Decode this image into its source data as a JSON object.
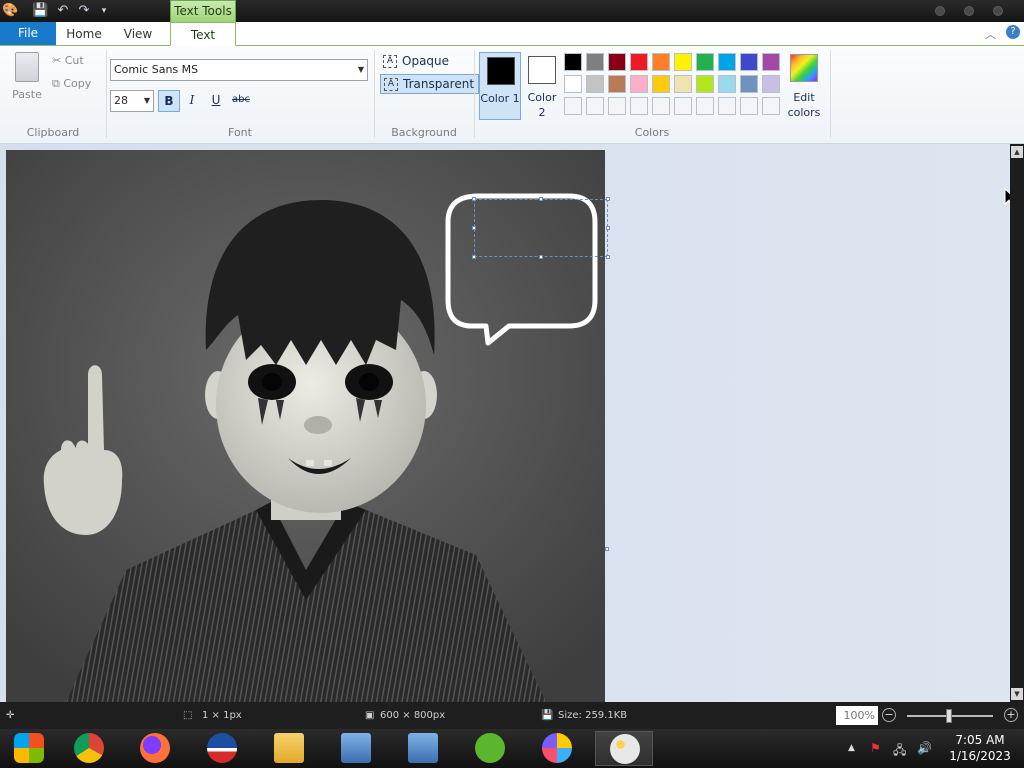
{
  "titlebar": {
    "context_tab": "Text Tools"
  },
  "tabs": {
    "file": "File",
    "home": "Home",
    "view": "View",
    "text": "Text"
  },
  "clipboard": {
    "paste": "Paste",
    "cut": "Cut",
    "copy": "Copy",
    "group": "Clipboard"
  },
  "font": {
    "family": "Comic Sans MS",
    "size": "28",
    "bold": "B",
    "italic": "I",
    "underline": "U",
    "strike": "abc",
    "group": "Font"
  },
  "background": {
    "opaque": "Opaque",
    "transparent": "Transparent",
    "group": "Background"
  },
  "colors": {
    "color1_label": "Color 1",
    "color2_label": "Color 2",
    "color1": "#000000",
    "color2": "#ffffff",
    "edit": "Edit colors",
    "group": "Colors",
    "palette_row1": [
      "#000000",
      "#7f7f7f",
      "#880015",
      "#ed1c24",
      "#ff7f27",
      "#fff200",
      "#22b14c",
      "#00a2e8",
      "#3f48cc",
      "#a349a4"
    ],
    "palette_row2": [
      "#ffffff",
      "#c3c3c3",
      "#b97a57",
      "#ffaec9",
      "#ffc90e",
      "#efe4b0",
      "#b5e61d",
      "#99d9ea",
      "#7092be",
      "#c8bfe7"
    ]
  },
  "status": {
    "selection": "1 × 1px",
    "image_size": "600 × 800px",
    "file_size": "Size: 259.1KB",
    "zoom": "100%"
  },
  "taskbar": {
    "time": "7:05 AM",
    "date": "1/16/2023"
  }
}
